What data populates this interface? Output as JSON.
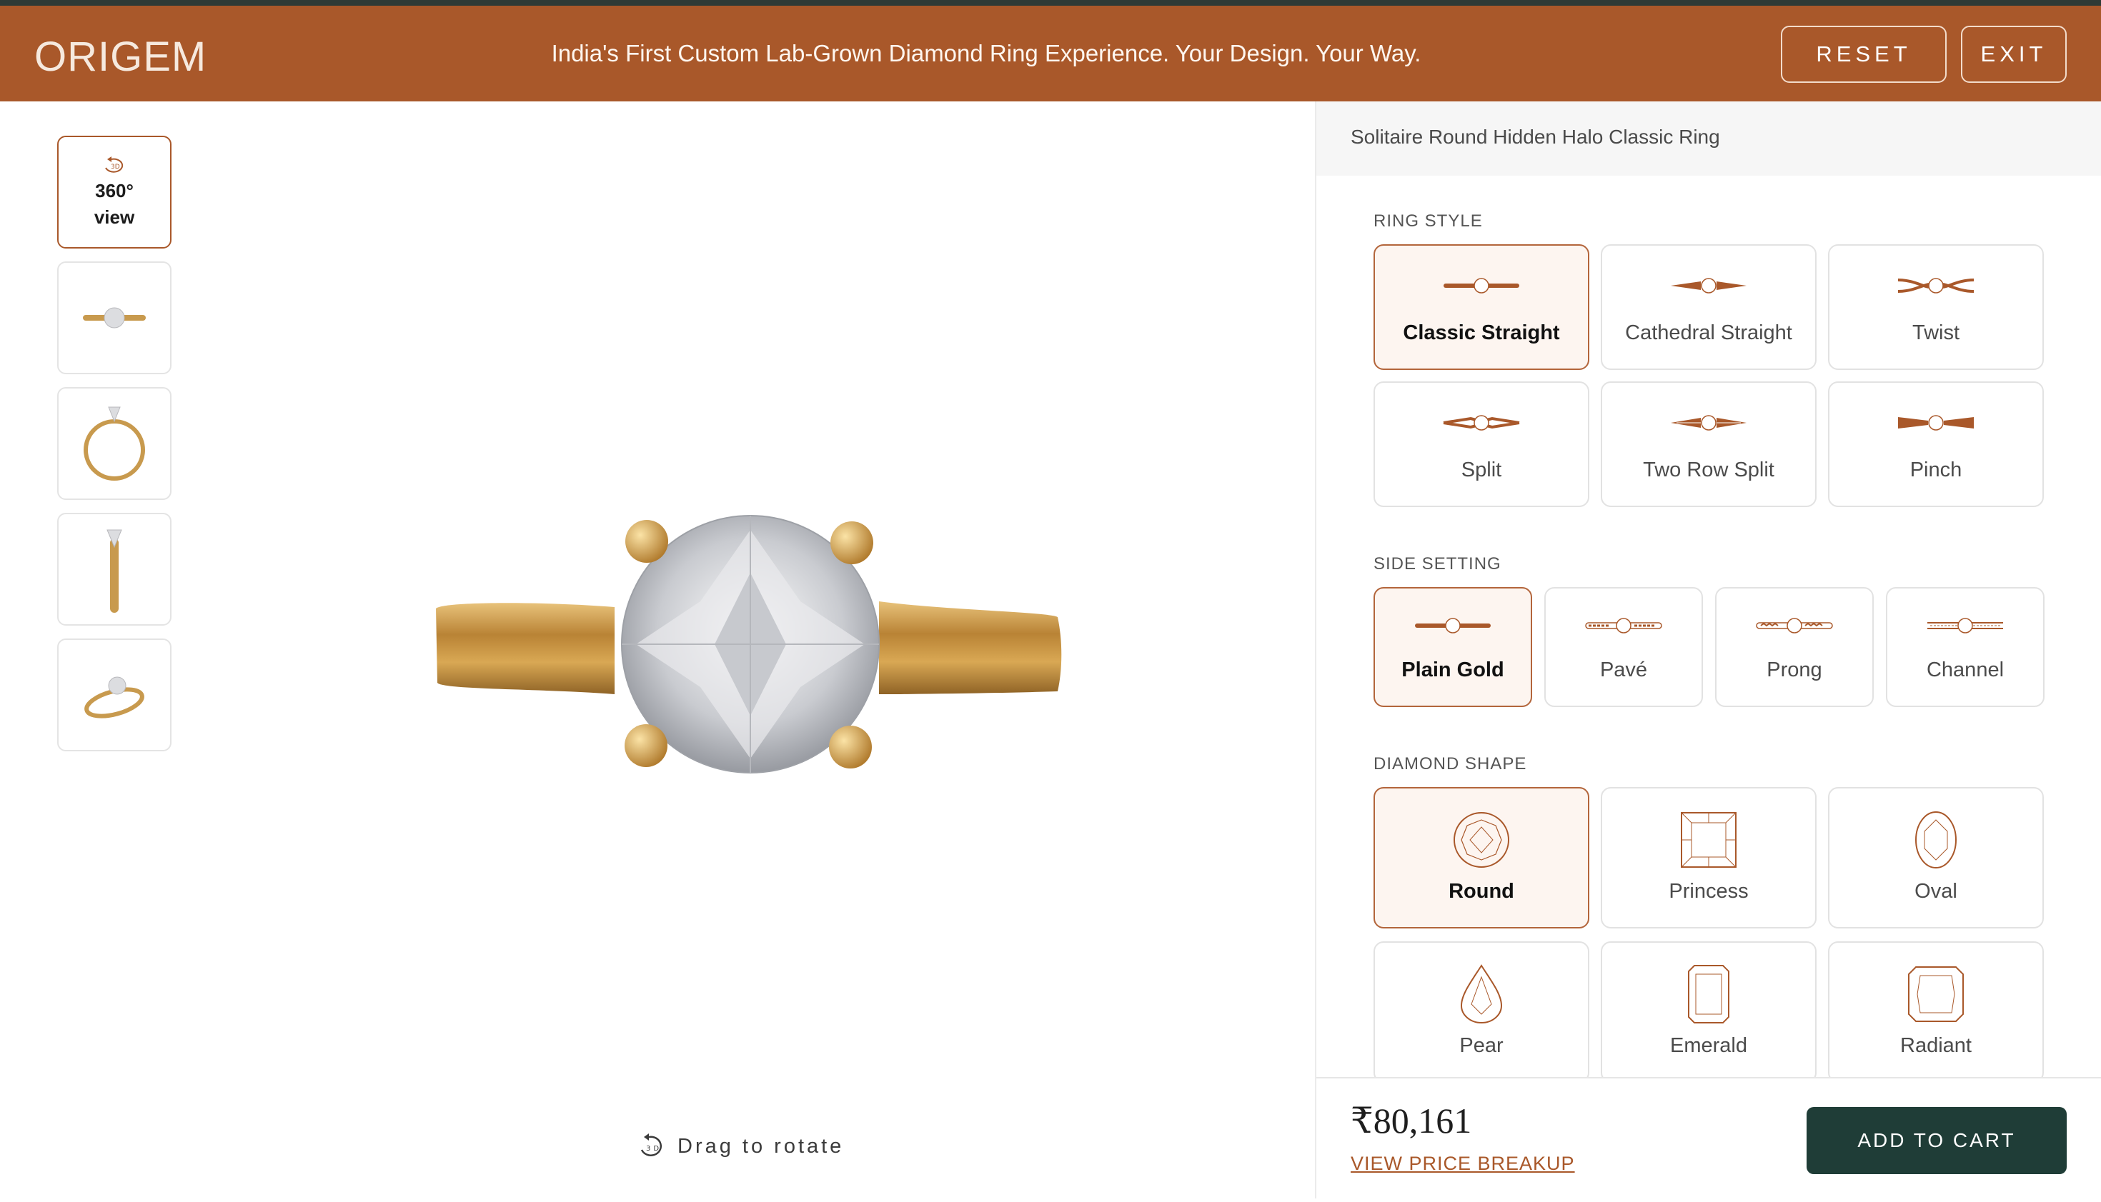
{
  "header": {
    "logo": "ORIGEM",
    "tagline": "India's First Custom Lab-Grown Diamond Ring Experience. Your Design. Your Way.",
    "reset_label": "RESET",
    "exit_label": "EXIT"
  },
  "thumbnails": {
    "view360_label_1": "360°",
    "view360_label_2": "view"
  },
  "viewer": {
    "drag_hint": "Drag to rotate"
  },
  "panel": {
    "product_title": "Solitaire Round Hidden Halo Classic Ring",
    "ring_style": {
      "label": "RING STYLE",
      "options": [
        "Classic Straight",
        "Cathedral Straight",
        "Twist",
        "Split",
        "Two Row Split",
        "Pinch"
      ],
      "selected": "Classic Straight"
    },
    "side_setting": {
      "label": "SIDE SETTING",
      "options": [
        "Plain Gold",
        "Pavé",
        "Prong",
        "Channel"
      ],
      "selected": "Plain Gold"
    },
    "diamond_shape": {
      "label": "DIAMOND SHAPE",
      "options": [
        "Round",
        "Princess",
        "Oval",
        "Pear",
        "Emerald",
        "Radiant"
      ],
      "selected": "Round"
    }
  },
  "footer": {
    "price": "₹80,161",
    "breakup_link": "VIEW PRICE BREAKUP",
    "cart_label": "ADD TO CART"
  },
  "colors": {
    "brand": "#a9582a",
    "dark_button": "#1f3d37",
    "gold": "#c89a4e"
  }
}
